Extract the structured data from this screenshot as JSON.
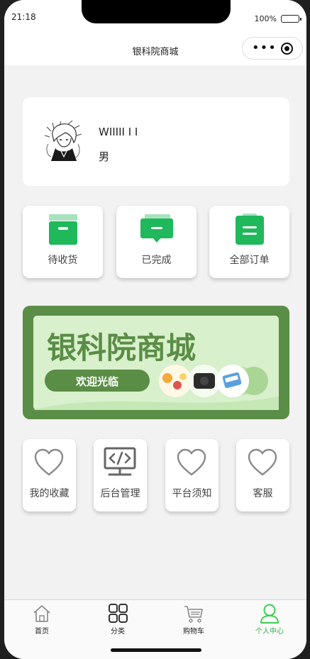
{
  "status_bar": {
    "time": "21:18",
    "battery": "100%"
  },
  "navbar": {
    "title": "银科院商城"
  },
  "profile": {
    "username": "WIIIII I I",
    "gender": "男"
  },
  "orders": [
    {
      "label": "待收货",
      "icon": "box-icon"
    },
    {
      "label": "已完成",
      "icon": "message-icon"
    },
    {
      "label": "全部订单",
      "icon": "clipboard-icon"
    }
  ],
  "banner": {
    "title": "银科院商城",
    "button": "欢迎光临"
  },
  "functions": [
    {
      "label": "我的收藏",
      "icon": "heart-icon"
    },
    {
      "label": "后台管理",
      "icon": "code-icon"
    },
    {
      "label": "平台须知",
      "icon": "heart-icon"
    },
    {
      "label": "客服",
      "icon": "heart-icon"
    }
  ],
  "tabbar": [
    {
      "label": "首页",
      "icon": "home-icon"
    },
    {
      "label": "分类",
      "icon": "grid-icon"
    },
    {
      "label": "购物车",
      "icon": "cart-icon"
    },
    {
      "label": "个人中心",
      "icon": "user-icon",
      "active": true
    }
  ],
  "colors": {
    "accent": "#1fb85b",
    "banner_bg": "#5a8d45",
    "tab_active": "#2fae47"
  }
}
